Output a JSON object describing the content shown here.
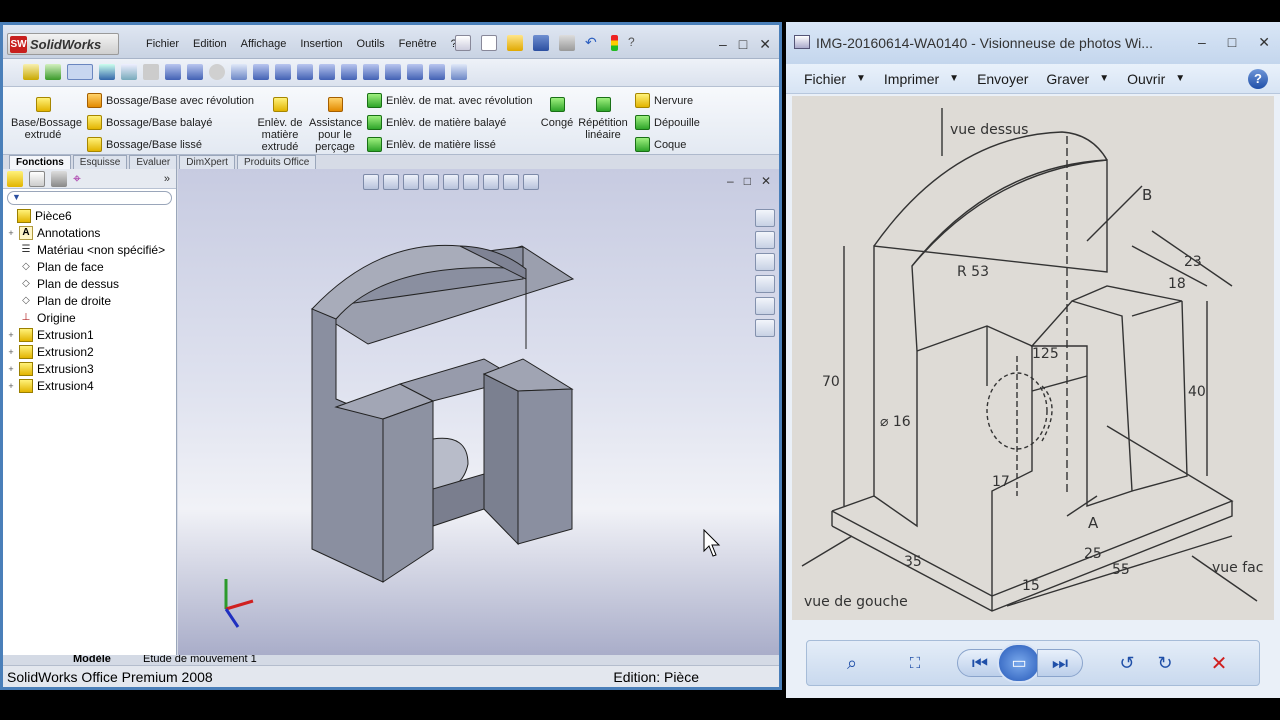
{
  "solidworks": {
    "app_name": "SolidWorks",
    "logo_mark": "SW",
    "menu": [
      "Fichier",
      "Edition",
      "Affichage",
      "Insertion",
      "Outils",
      "Fenêtre"
    ],
    "menu_help": "?",
    "window_controls": [
      "–",
      "□",
      "✕"
    ],
    "ribbon": {
      "base_extrude": "Base/Bossage extrudé",
      "boss_revolve": "Bossage/Base avec révolution",
      "boss_sweep": "Bossage/Base balayé",
      "boss_loft": "Bossage/Base lissé",
      "cut_extrude": "Enlèv. de matière extrudé",
      "hole_wizard": "Assistance pour le perçage",
      "cut_revolve": "Enlèv. de mat. avec révolution",
      "cut_sweep": "Enlèv. de matière balayé",
      "cut_loft": "Enlèv. de matière lissé",
      "fillet": "Congé",
      "linear_pattern": "Répétition linéaire",
      "rib": "Nervure",
      "draft": "Dépouille",
      "shell": "Coque"
    },
    "tabs": [
      "Fonctions",
      "Esquisse",
      "Evaluer",
      "DimXpert",
      "Produits Office"
    ],
    "active_tab": "Fonctions",
    "tree": [
      {
        "label": "Pièce6",
        "icon": "part-icon",
        "level": 0
      },
      {
        "label": "Annotations",
        "icon": "annotations-icon",
        "level": 1,
        "expander": "+"
      },
      {
        "label": "Matériau <non spécifié>",
        "icon": "material-icon",
        "level": 1
      },
      {
        "label": "Plan de face",
        "icon": "plane-icon",
        "level": 1
      },
      {
        "label": "Plan de dessus",
        "icon": "plane-icon",
        "level": 1
      },
      {
        "label": "Plan de droite",
        "icon": "plane-icon",
        "level": 1
      },
      {
        "label": "Origine",
        "icon": "origin-icon",
        "level": 1
      },
      {
        "label": "Extrusion1",
        "icon": "extrude-icon",
        "level": 1,
        "expander": "+"
      },
      {
        "label": "Extrusion2",
        "icon": "extrude-icon",
        "level": 1,
        "expander": "+"
      },
      {
        "label": "Extrusion3",
        "icon": "extrude-icon",
        "level": 1,
        "expander": "+"
      },
      {
        "label": "Extrusion4",
        "icon": "extrude-icon",
        "level": 1,
        "expander": "+"
      }
    ],
    "bottom_tabs": [
      "Modèle",
      "Etude de mouvement 1"
    ],
    "status_left": "SolidWorks Office Premium 2008",
    "status_right": "Edition: Pièce",
    "colors": {
      "frame": "#4a7fb9",
      "part_face": "#8a8f9e"
    }
  },
  "photo_viewer": {
    "title": "IMG-20160614-WA0140 - Visionneuse de photos Wi...",
    "window_controls": [
      "–",
      "□",
      "✕"
    ],
    "menu": [
      "Fichier",
      "Imprimer",
      "Envoyer",
      "Graver",
      "Ouvrir"
    ],
    "menu_carets": [
      "▼",
      "▼",
      "",
      "▼",
      "▼"
    ],
    "help": "?",
    "drawing_labels": {
      "top_view": "vue dessus",
      "left_view": "vue de gouche",
      "front_view": "vue fac",
      "label_b": "B",
      "label_a": "A",
      "dim_r53": "R 53",
      "dim_23": "23",
      "dim_18": "18",
      "dim_70": "70",
      "dim_40": "40",
      "dim_125": "125",
      "dim_d16": "⌀ 16",
      "dim_17": "17",
      "dim_25": "25",
      "dim_55": "55",
      "dim_15": "15",
      "dim_35": "35"
    },
    "controls": [
      "zoom-icon",
      "fit-icon",
      "prev-icon",
      "slideshow-icon",
      "next-icon",
      "rotate-left-icon",
      "rotate-right-icon",
      "delete-icon"
    ]
  }
}
